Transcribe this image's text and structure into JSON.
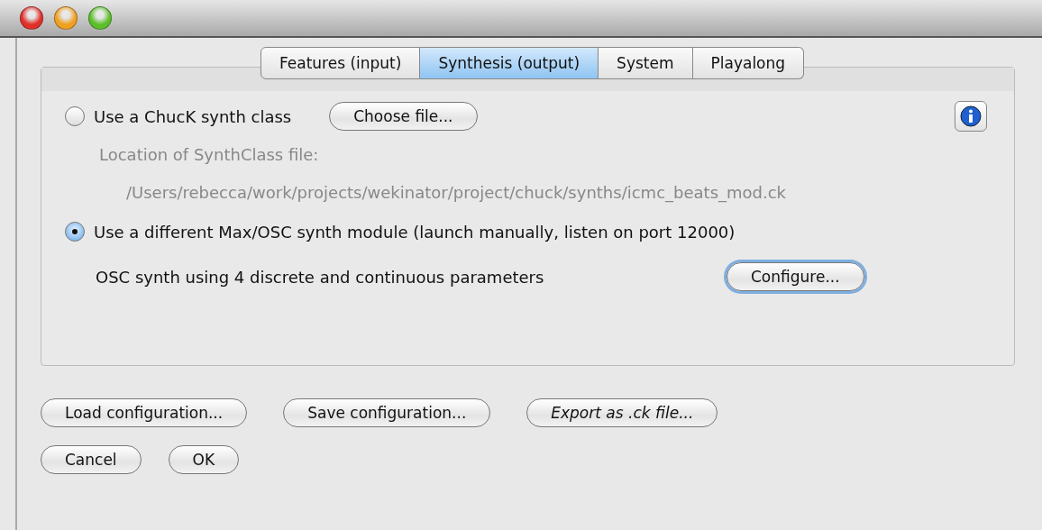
{
  "tabs": [
    {
      "label": "Features (input)",
      "selected": false
    },
    {
      "label": "Synthesis (output)",
      "selected": true
    },
    {
      "label": "System",
      "selected": false
    },
    {
      "label": "Playalong",
      "selected": false
    }
  ],
  "chuck_option": {
    "label": "Use a ChucK synth class",
    "selected": false,
    "button": "Choose file...",
    "location_label": "Location of SynthClass file:",
    "location_path": "/Users/rebecca/work/projects/wekinator/project/chuck/synths/icmc_beats_mod.ck"
  },
  "osc_option": {
    "label": "Use a different Max/OSC synth module (launch manually, listen on port 12000)",
    "selected": true,
    "description": "OSC synth using 4 discrete and continuous parameters",
    "button": "Configure...",
    "focused": true
  },
  "config_buttons": [
    {
      "label": "Load configuration...",
      "italic": false
    },
    {
      "label": "Save configuration...",
      "italic": false
    },
    {
      "label": "Export as .ck file...",
      "italic": true
    }
  ],
  "dialog_buttons": [
    "Cancel",
    "OK"
  ]
}
